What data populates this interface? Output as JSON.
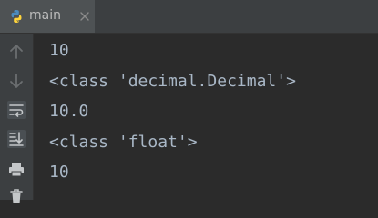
{
  "tab": {
    "label": "main",
    "icon": "python-icon",
    "close_icon": "close-icon"
  },
  "gutter": {
    "buttons": [
      {
        "name": "scroll-up",
        "icon": "arrow-up-icon"
      },
      {
        "name": "scroll-down",
        "icon": "arrow-down-icon"
      },
      {
        "name": "soft-wrap",
        "icon": "soft-wrap-icon"
      },
      {
        "name": "scroll-to-end",
        "icon": "scroll-to-end-icon"
      },
      {
        "name": "print",
        "icon": "printer-icon"
      },
      {
        "name": "clear-all",
        "icon": "trash-icon"
      }
    ]
  },
  "console": {
    "lines": [
      "10",
      "<class 'decimal.Decimal'>",
      "10.0",
      "<class 'float'>",
      "10"
    ]
  },
  "colors": {
    "background": "#2b2b2b",
    "panel": "#3c3f41",
    "text": "#a9b7c6"
  }
}
